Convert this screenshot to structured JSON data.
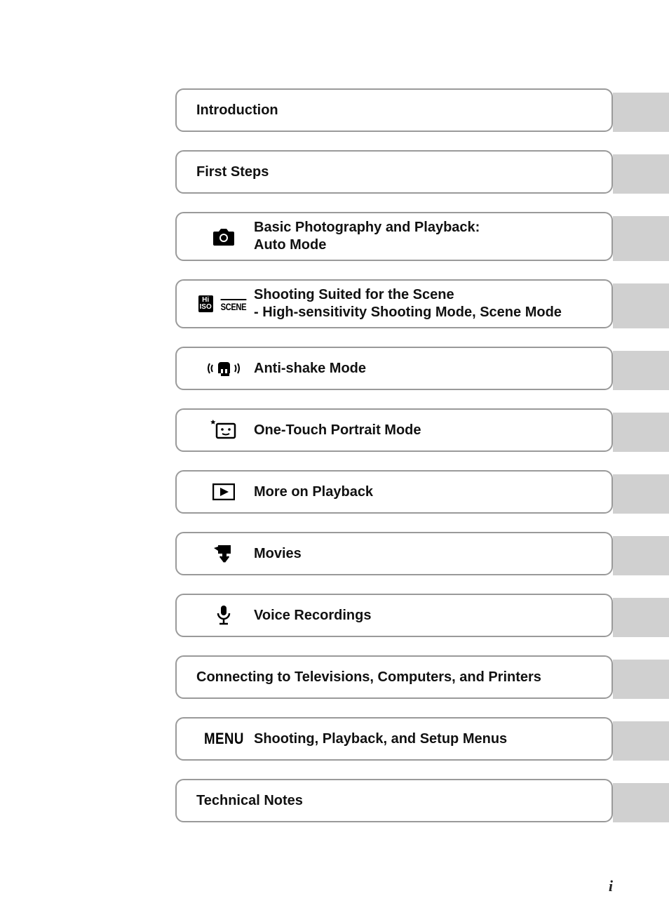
{
  "page_number": "i",
  "toc": [
    {
      "icon": null,
      "title": "Introduction"
    },
    {
      "icon": null,
      "title": "First Steps"
    },
    {
      "icon": "camera",
      "title": "Basic Photography and Playback:",
      "title2": "Auto Mode"
    },
    {
      "icon": "scene",
      "title": "Shooting Suited for the Scene",
      "title2": "- High-sensitivity Shooting Mode, Scene Mode"
    },
    {
      "icon": "antishake",
      "title": "Anti-shake Mode"
    },
    {
      "icon": "portrait",
      "title": "One-Touch Portrait Mode"
    },
    {
      "icon": "playback",
      "title": "More on Playback"
    },
    {
      "icon": "movie",
      "title": "Movies"
    },
    {
      "icon": "mic",
      "title": "Voice Recordings"
    },
    {
      "icon": null,
      "title": "Connecting to Televisions, Computers, and Printers"
    },
    {
      "icon": "menu",
      "title": "Shooting, Playback, and Setup Menus"
    },
    {
      "icon": null,
      "title": "Technical Notes"
    }
  ],
  "icon_labels": {
    "hi_iso_line1": "Hi",
    "hi_iso_line2": "ISO",
    "scene": "SCENE",
    "menu": "MENU"
  }
}
